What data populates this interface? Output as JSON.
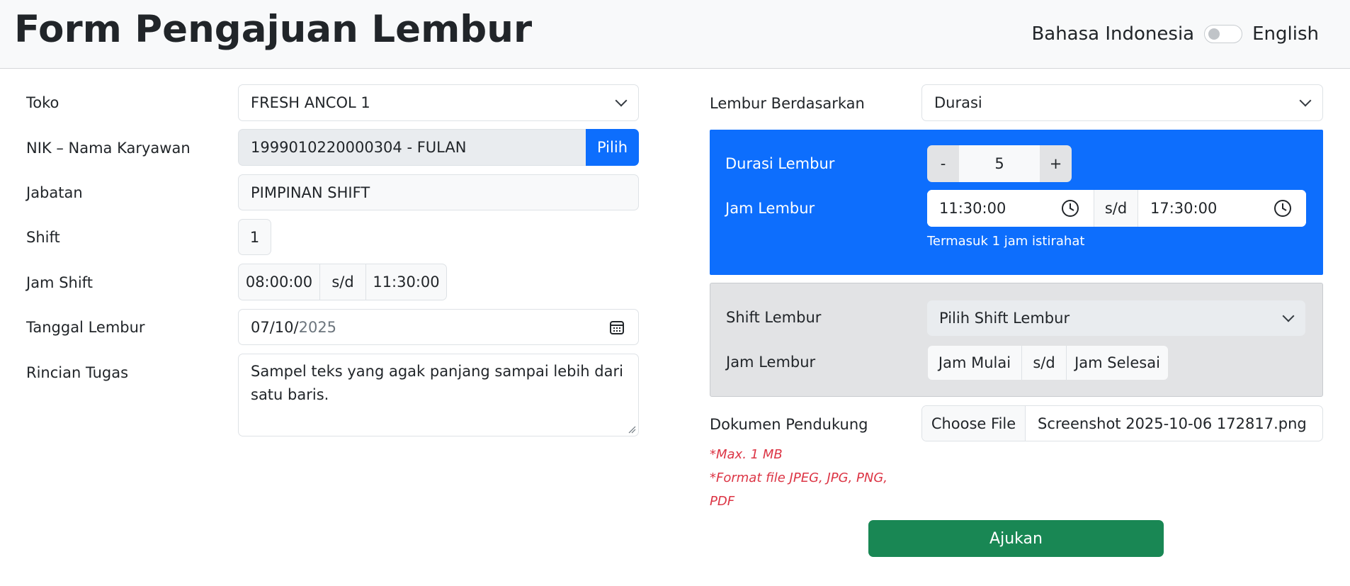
{
  "header": {
    "title": "Form Pengajuan Lembur",
    "lang_left": "Bahasa Indonesia",
    "lang_right": "English"
  },
  "left_form": {
    "toko": {
      "label": "Toko",
      "value": "FRESH ANCOL 1"
    },
    "nik": {
      "label": "NIK – Nama Karyawan",
      "value": "1999010220000304 - FULAN",
      "button": "Pilih"
    },
    "jabatan": {
      "label": "Jabatan",
      "value": "PIMPINAN SHIFT"
    },
    "shift": {
      "label": "Shift",
      "value": "1"
    },
    "jam_shift": {
      "label": "Jam Shift",
      "start": "08:00:00",
      "sep": "s/d",
      "end": "11:30:00"
    },
    "tanggal": {
      "label": "Tanggal Lembur",
      "date_mmdd": "07/10/",
      "date_year": "2025"
    },
    "rincian": {
      "label": "Rincian Tugas",
      "value": "Sampel teks yang agak panjang sampai lebih dari satu baris."
    }
  },
  "right_form": {
    "basis": {
      "label": "Lembur Berdasarkan",
      "value": "Durasi"
    },
    "durasi_panel": {
      "durasi_label": "Durasi Lembur",
      "minus": "-",
      "value": "5",
      "plus": "+",
      "jam_label": "Jam Lembur",
      "start": "11:30:00",
      "sep": "s/d",
      "end": "17:30:00",
      "note": "Termasuk 1 jam istirahat"
    },
    "shift_panel": {
      "shift_label": "Shift Lembur",
      "shift_select": "Pilih Shift Lembur",
      "jam_label": "Jam Lembur",
      "start": "Jam Mulai",
      "sep": "s/d",
      "end": "Jam Selesai"
    },
    "dokumen": {
      "label": "Dokumen Pendukung",
      "choose": "Choose File",
      "filename": "Screenshot 2025-10-06 172817.png",
      "hint1": "*Max. 1 MB",
      "hint2": "*Format file JPEG, JPG, PNG,",
      "hint3": "PDF"
    },
    "submit": "Ajukan"
  },
  "colors": {
    "primary": "#0d6efd",
    "success": "#198754",
    "danger": "#dc3545",
    "panel_gray": "#e2e3e5"
  }
}
